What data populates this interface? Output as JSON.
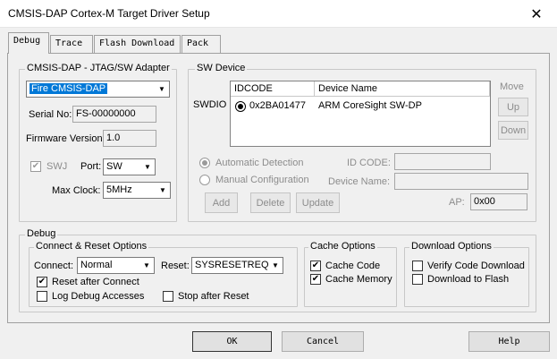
{
  "window": {
    "title": "CMSIS-DAP Cortex-M Target Driver Setup",
    "close_glyph": "✕"
  },
  "tabs": [
    {
      "label": "Debug",
      "active": true
    },
    {
      "label": "Trace",
      "active": false
    },
    {
      "label": "Flash Download",
      "active": false
    },
    {
      "label": "Pack",
      "active": false
    }
  ],
  "adapter": {
    "legend": "CMSIS-DAP - JTAG/SW Adapter",
    "selected": "Fire CMSIS-DAP",
    "serial_label": "Serial No:",
    "serial_value": "FS-00000000",
    "firmware_label": "Firmware Version:",
    "firmware_value": "1.0",
    "swj_label": "SWJ",
    "port_label": "Port:",
    "port_value": "SW",
    "maxclock_label": "Max Clock:",
    "maxclock_value": "5MHz"
  },
  "sw_device": {
    "legend": "SW Device",
    "swdio_label": "SWDIO",
    "col_idcode": "IDCODE",
    "col_devname": "Device Name",
    "row_idcode": "0x2BA01477",
    "row_devname": "ARM CoreSight SW-DP",
    "move_label": "Move",
    "up_label": "Up",
    "down_label": "Down",
    "auto_detect_label": "Automatic Detection",
    "manual_config_label": "Manual Configuration",
    "id_code_label": "ID CODE:",
    "device_name_label": "Device Name:",
    "add_label": "Add",
    "delete_label": "Delete",
    "update_label": "Update",
    "ap_label": "AP:",
    "ap_value": "0x00"
  },
  "debug": {
    "legend": "Debug",
    "connect_reset": {
      "legend": "Connect & Reset Options",
      "connect_label": "Connect:",
      "connect_value": "Normal",
      "reset_label": "Reset:",
      "reset_value": "SYSRESETREQ",
      "reset_after_connect": "Reset after Connect",
      "log_debug_accesses": "Log Debug Accesses",
      "stop_after_reset": "Stop after Reset"
    },
    "cache": {
      "legend": "Cache Options",
      "cache_code": "Cache Code",
      "cache_memory": "Cache Memory"
    },
    "download": {
      "legend": "Download Options",
      "verify": "Verify Code Download",
      "to_flash": "Download to Flash"
    }
  },
  "footer": {
    "ok_label": "OK",
    "cancel_label": "Cancel",
    "help_label": "Help"
  },
  "glyphs": {
    "check": "✔",
    "arrow": "▼"
  }
}
